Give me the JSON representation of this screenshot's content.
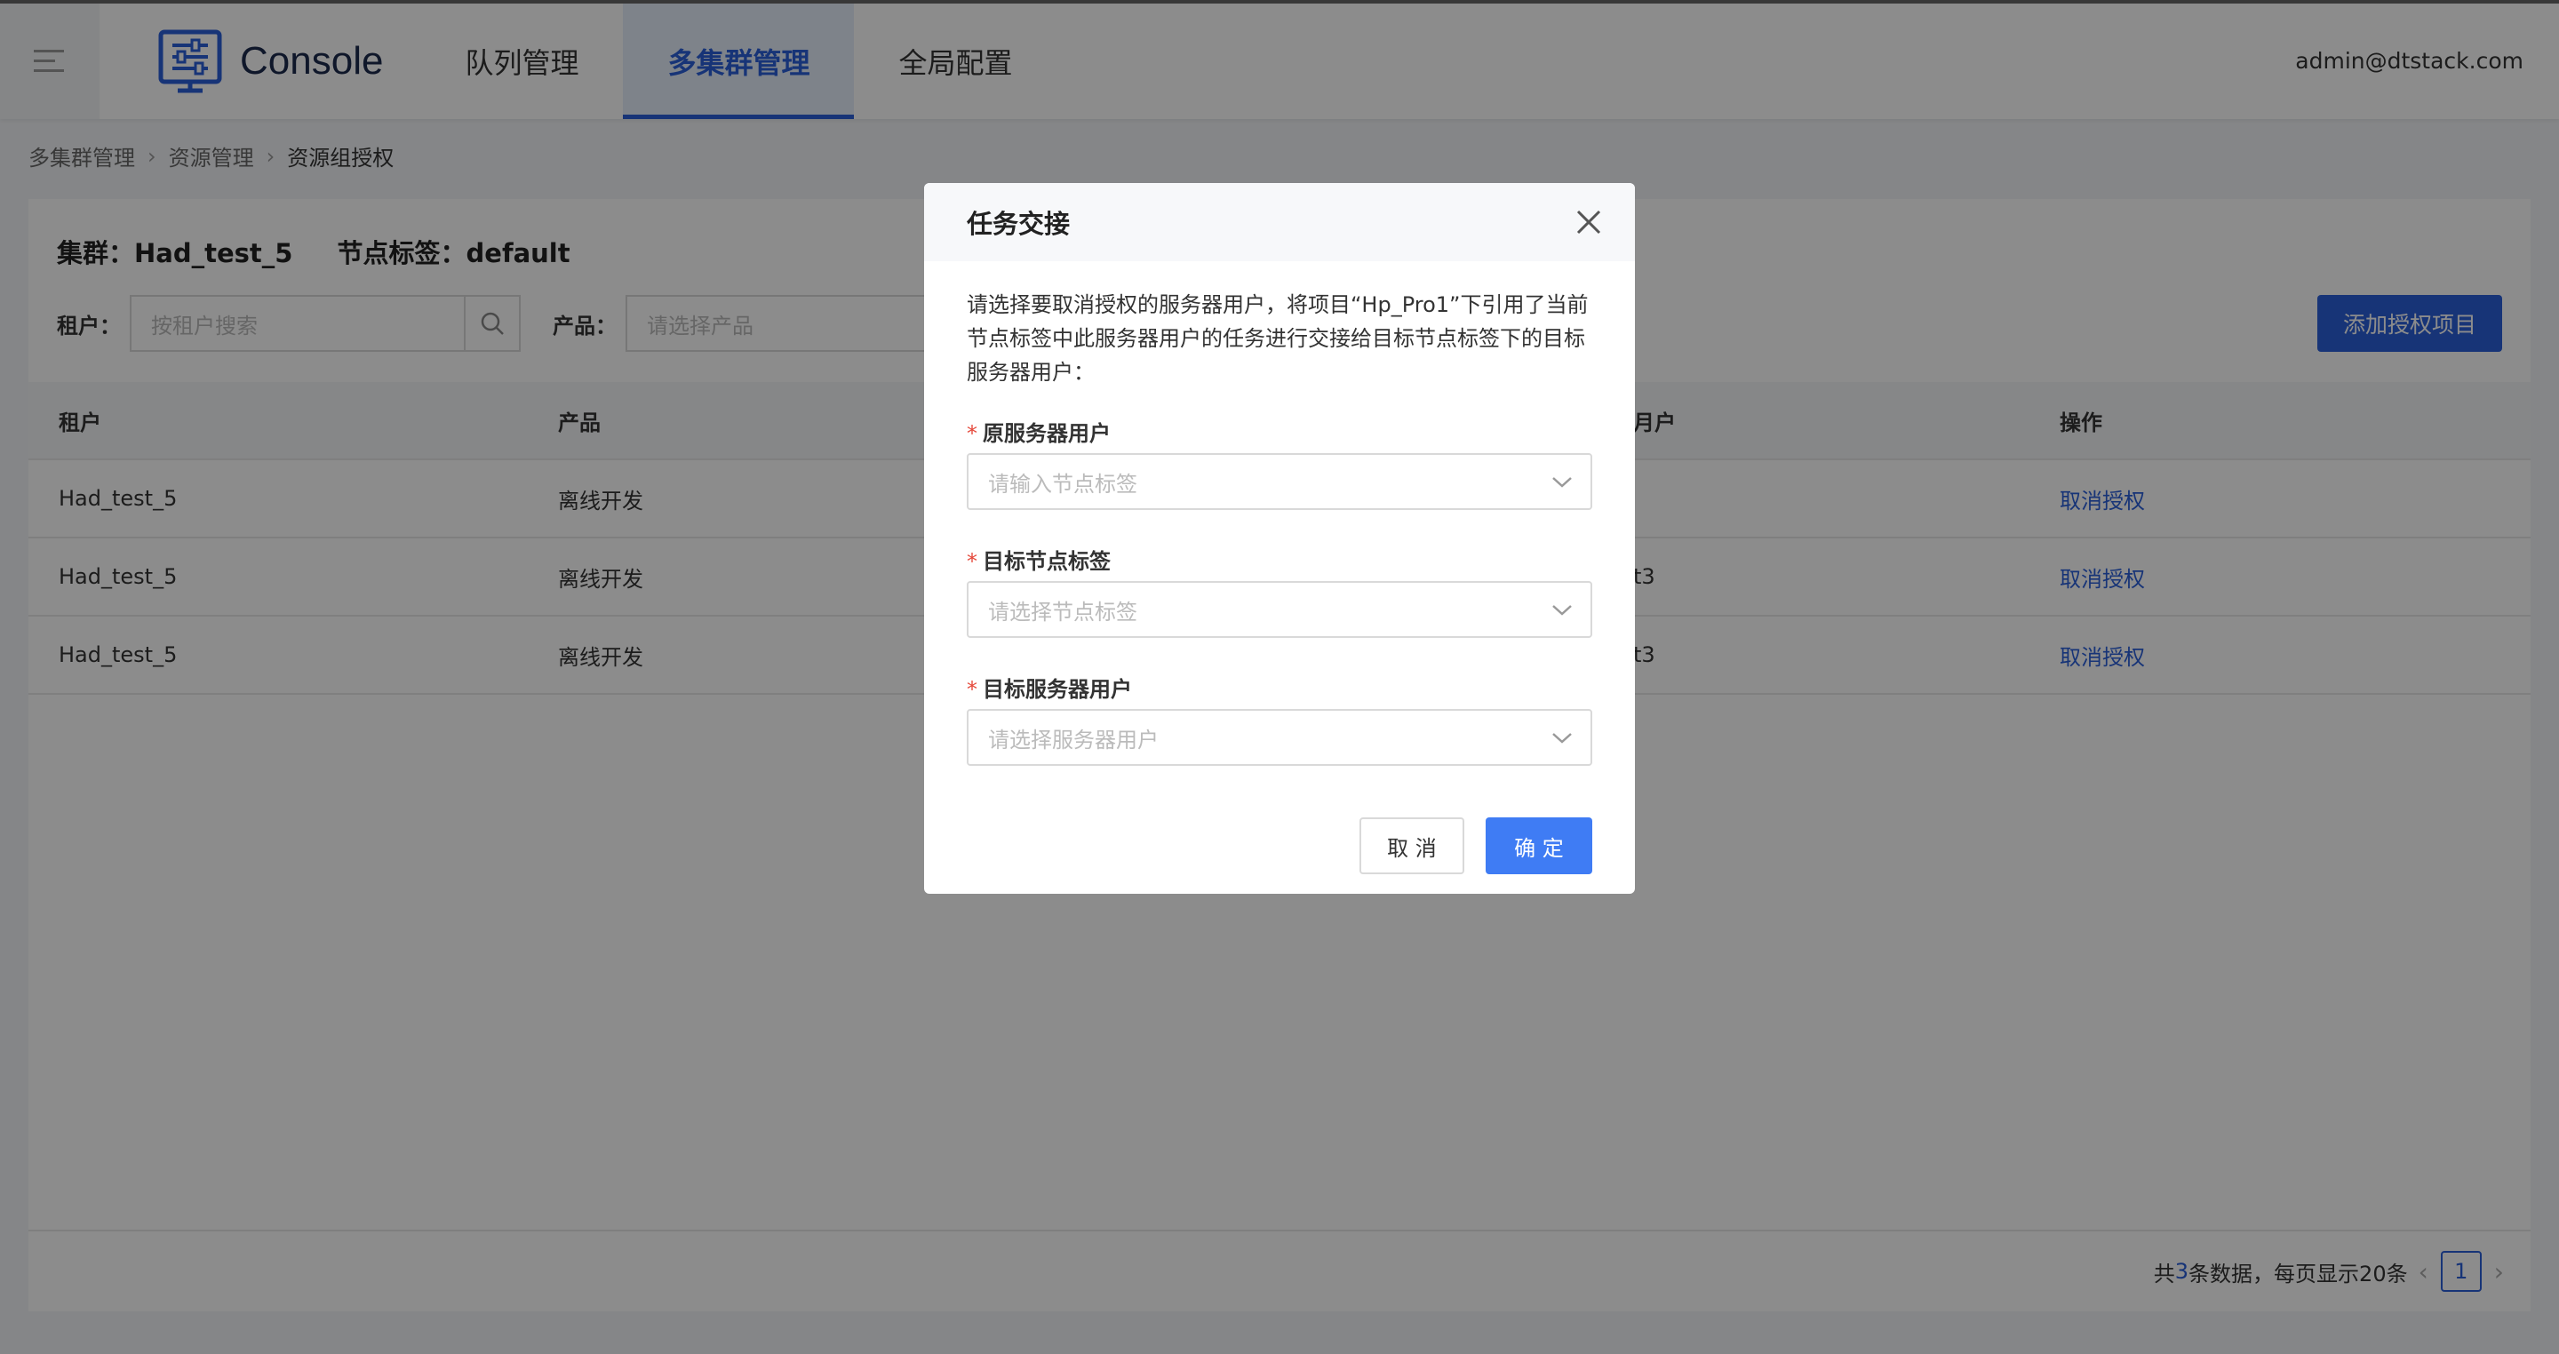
{
  "header": {
    "logo_text": "Console",
    "nav": [
      "队列管理",
      "多集群管理",
      "全局配置"
    ],
    "user": "admin@dtstack.com"
  },
  "breadcrumb": [
    "多集群管理",
    "资源管理",
    "资源组授权"
  ],
  "info": {
    "cluster": "集群：Had_test_5",
    "tag": "节点标签：default"
  },
  "filters": {
    "tenant_label": "租户：",
    "tenant_placeholder": "按租户搜索",
    "product_label": "产品：",
    "product_placeholder": "请选择产品",
    "add_button": "添加授权项目"
  },
  "table": {
    "headers": [
      "租户",
      "产品",
      "月户",
      "操作"
    ],
    "rows": [
      {
        "tenant": "Had_test_5",
        "product": "离线开发",
        "user": "",
        "action": "取消授权"
      },
      {
        "tenant": "Had_test_5",
        "product": "离线开发",
        "user": "t3",
        "action": "取消授权"
      },
      {
        "tenant": "Had_test_5",
        "product": "离线开发",
        "user": "t3",
        "action": "取消授权"
      }
    ]
  },
  "pagination": {
    "prefix": "共",
    "total": "3",
    "suffix": "条数据，每页显示20条",
    "current": "1"
  },
  "modal": {
    "title": "任务交接",
    "description": "请选择要取消授权的服务器用户，将项目“Hp_Pro1”下引用了当前节点标签中此服务器用户的任务进行交接给目标节点标签下的目标服务器用户：",
    "fields": [
      {
        "label": "原服务器用户",
        "placeholder": "请输入节点标签"
      },
      {
        "label": "目标节点标签",
        "placeholder": "请选择节点标签"
      },
      {
        "label": "目标服务器用户",
        "placeholder": "请选择服务器用户"
      }
    ],
    "cancel": "取 消",
    "ok": "确 定"
  },
  "colors": {
    "primary": "#2b5fd9",
    "ok_button": "#3f7cf4",
    "required": "#e5483a"
  }
}
